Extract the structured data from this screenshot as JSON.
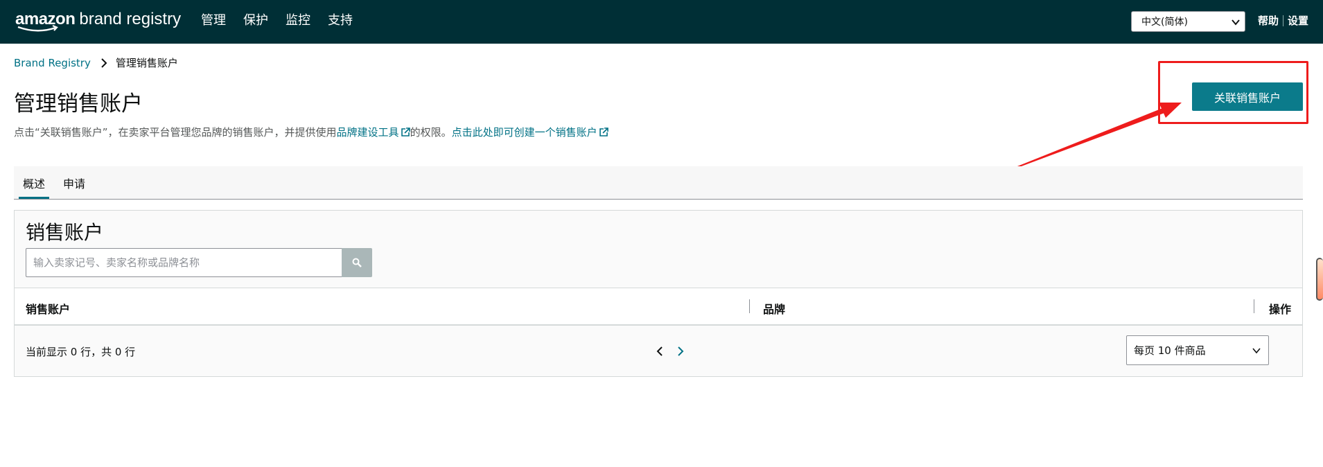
{
  "header": {
    "logo_amazon": "amazon",
    "logo_rest": "brand registry",
    "nav": [
      "管理",
      "保护",
      "监控",
      "支持"
    ],
    "language": "中文(简体)",
    "help": "帮助",
    "settings": "设置"
  },
  "breadcrumb": {
    "root": "Brand Registry",
    "current": "管理销售账户"
  },
  "page": {
    "title": "管理销售账户",
    "desc_prefix": "点击“关联销售账户”，在卖家平台管理您品牌的销售账户，并提供使用",
    "desc_link1": "品牌建设工具",
    "desc_middle": "的权限。",
    "desc_link2": "点击此处即可创建一个销售账户",
    "primary_button": "关联销售账户"
  },
  "tabs": [
    {
      "label": "概述",
      "active": true
    },
    {
      "label": "申请",
      "active": false
    }
  ],
  "panel": {
    "title": "销售账户",
    "search_placeholder": "输入卖家记号、卖家名称或品牌名称",
    "columns": [
      "销售账户",
      "品牌",
      "操作"
    ],
    "status": "当前显示 0 行，共 0 行",
    "per_page": "每页 10 件商品"
  },
  "colors": {
    "nav_bg": "#002f36",
    "primary": "#0b7b8b",
    "link": "#007185",
    "annotation": "#ee1c1c"
  }
}
